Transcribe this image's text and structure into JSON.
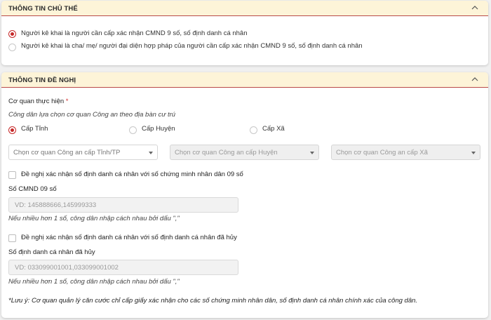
{
  "section_subject": {
    "title": "THÔNG TIN CHỦ THỂ",
    "option_self": "Người kê khai là người cần cấp xác nhận CMND 9 số, số định danh cá nhân",
    "option_guardian": "Người kê khai là cha/ mẹ/ người đại diện hợp pháp của người cần cấp xác nhận CMND 9 số, số định danh cá nhân",
    "selected": "option_self"
  },
  "section_request": {
    "title": "THÔNG TIN ĐỀ NGHỊ",
    "agency_label": "Cơ quan thực hiện",
    "required_mark": "*",
    "agency_hint": "Công dân lựa chọn cơ quan Công an theo địa bàn cư trú",
    "level_options": [
      "Cấp Tỉnh",
      "Cấp Huyện",
      "Cấp Xã"
    ],
    "level_selected": "Cấp Tỉnh",
    "select_province": "Chọn cơ quan Công an cấp Tỉnh/TP",
    "select_district": "Chọn cơ quan Công an cấp Huyện",
    "select_commune": "Chọn cơ quan Công an cấp Xã",
    "check_cmnd_label": "Đề nghị xác nhận số định danh cá nhân với số chứng minh nhân dân 09 số",
    "cmnd_field_label": "Số CMND 09 số",
    "cmnd_placeholder": "VD: 145888666,145999333",
    "cmnd_hint": "Nếu nhiều hơn 1 số, công dân nhập cách nhau bởi dấu \",\"",
    "check_cancelled_label": "Đề nghị xác nhận số định danh cá nhân với số định danh cá nhân đã hủy",
    "cancelled_field_label": "Số định danh cá nhân đã hủy",
    "cancelled_placeholder": "VD: 033099001001,033099001002",
    "cancelled_hint": "Nếu nhiều hơn 1 số, công dân nhập cách nhau bởi dấu \",\"",
    "note": "*Lưu ý: Cơ quan quản lý căn cước chỉ cấp giấy xác nhận cho các số chứng minh nhân dân, số định danh cá nhân chính xác của công dân."
  },
  "colors": {
    "accent": "#c62828",
    "header_bg": "#fdf4d8"
  },
  "icons": {
    "collapse": "chevron-up-icon",
    "dropdown": "caret-down-icon"
  }
}
